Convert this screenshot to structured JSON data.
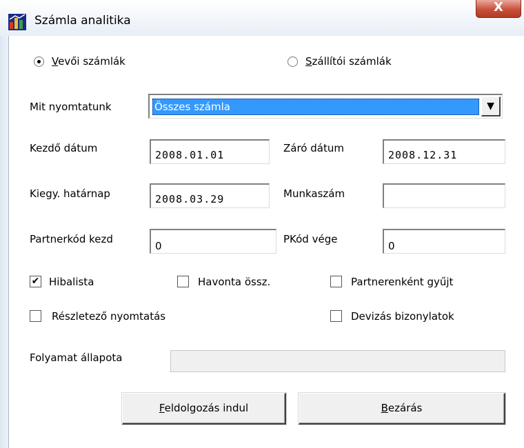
{
  "window": {
    "title": "Számla analitika",
    "close_label": "X"
  },
  "icons": {
    "app": "app-icon",
    "close": "close-icon"
  },
  "invoice_type": {
    "customer": {
      "access_key": "V",
      "rest": "evői számlák",
      "selected": true
    },
    "supplier": {
      "access_key": "S",
      "rest": "zállítói számlák",
      "selected": false
    }
  },
  "print_what": {
    "label": "Mit nyomtatunk",
    "selected": "Összes számla",
    "arrow": "▼"
  },
  "fields": {
    "start_date": {
      "label": "Kezdő dátum",
      "value": "2008.01.01"
    },
    "end_date": {
      "label": "Záró dátum",
      "value": "2008.12.31"
    },
    "deadline": {
      "label": "Kiegy. határnap",
      "value": "2008.03.29"
    },
    "job_number": {
      "label": "Munkaszám",
      "value": ""
    },
    "partner_start": {
      "label": "Partnerkód kezd",
      "value": "0"
    },
    "partner_end": {
      "label": "PKód vége",
      "value": "0"
    }
  },
  "options": {
    "error_list": {
      "label": "Hibalista",
      "checked": true,
      "mark": "✔"
    },
    "monthly_sum": {
      "label": "Havonta össz.",
      "checked": false
    },
    "by_partner": {
      "label": "Partnerenként gyűjt",
      "checked": false
    },
    "detailed_print": {
      "label": "Részletező nyomtatás",
      "checked": false
    },
    "currency_docs": {
      "label": "Devizás bizonylatok",
      "checked": false
    }
  },
  "progress": {
    "label": "Folyamat állapota",
    "value": 0
  },
  "buttons": {
    "start": {
      "access_key": "F",
      "rest": "eldolgozás indul"
    },
    "close": {
      "access_key": "B",
      "rest": "ezárás"
    }
  }
}
